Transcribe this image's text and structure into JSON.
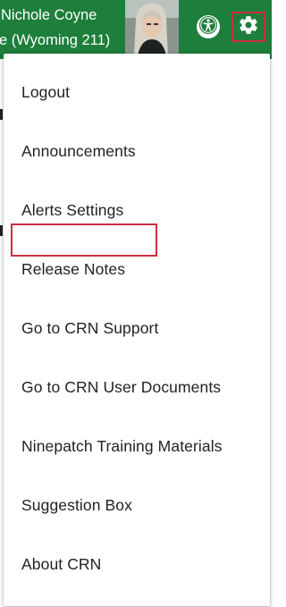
{
  "header": {
    "user_name": "Nichole Coyne",
    "user_location": "e (Wyoming 211)",
    "accent_color": "#1e7e3b",
    "highlight_color": "#c9303f"
  },
  "icons": {
    "accessibility": "accessibility-icon",
    "settings": "gear-icon"
  },
  "menu": {
    "items": [
      {
        "label": "Logout"
      },
      {
        "label": "Announcements"
      },
      {
        "label": "Alerts Settings",
        "highlighted": true
      },
      {
        "label": "Release Notes"
      },
      {
        "label": "Go to CRN Support"
      },
      {
        "label": "Go to CRN User Documents"
      },
      {
        "label": "Ninepatch Training Materials"
      },
      {
        "label": "Suggestion Box"
      },
      {
        "label": "About CRN"
      }
    ]
  }
}
